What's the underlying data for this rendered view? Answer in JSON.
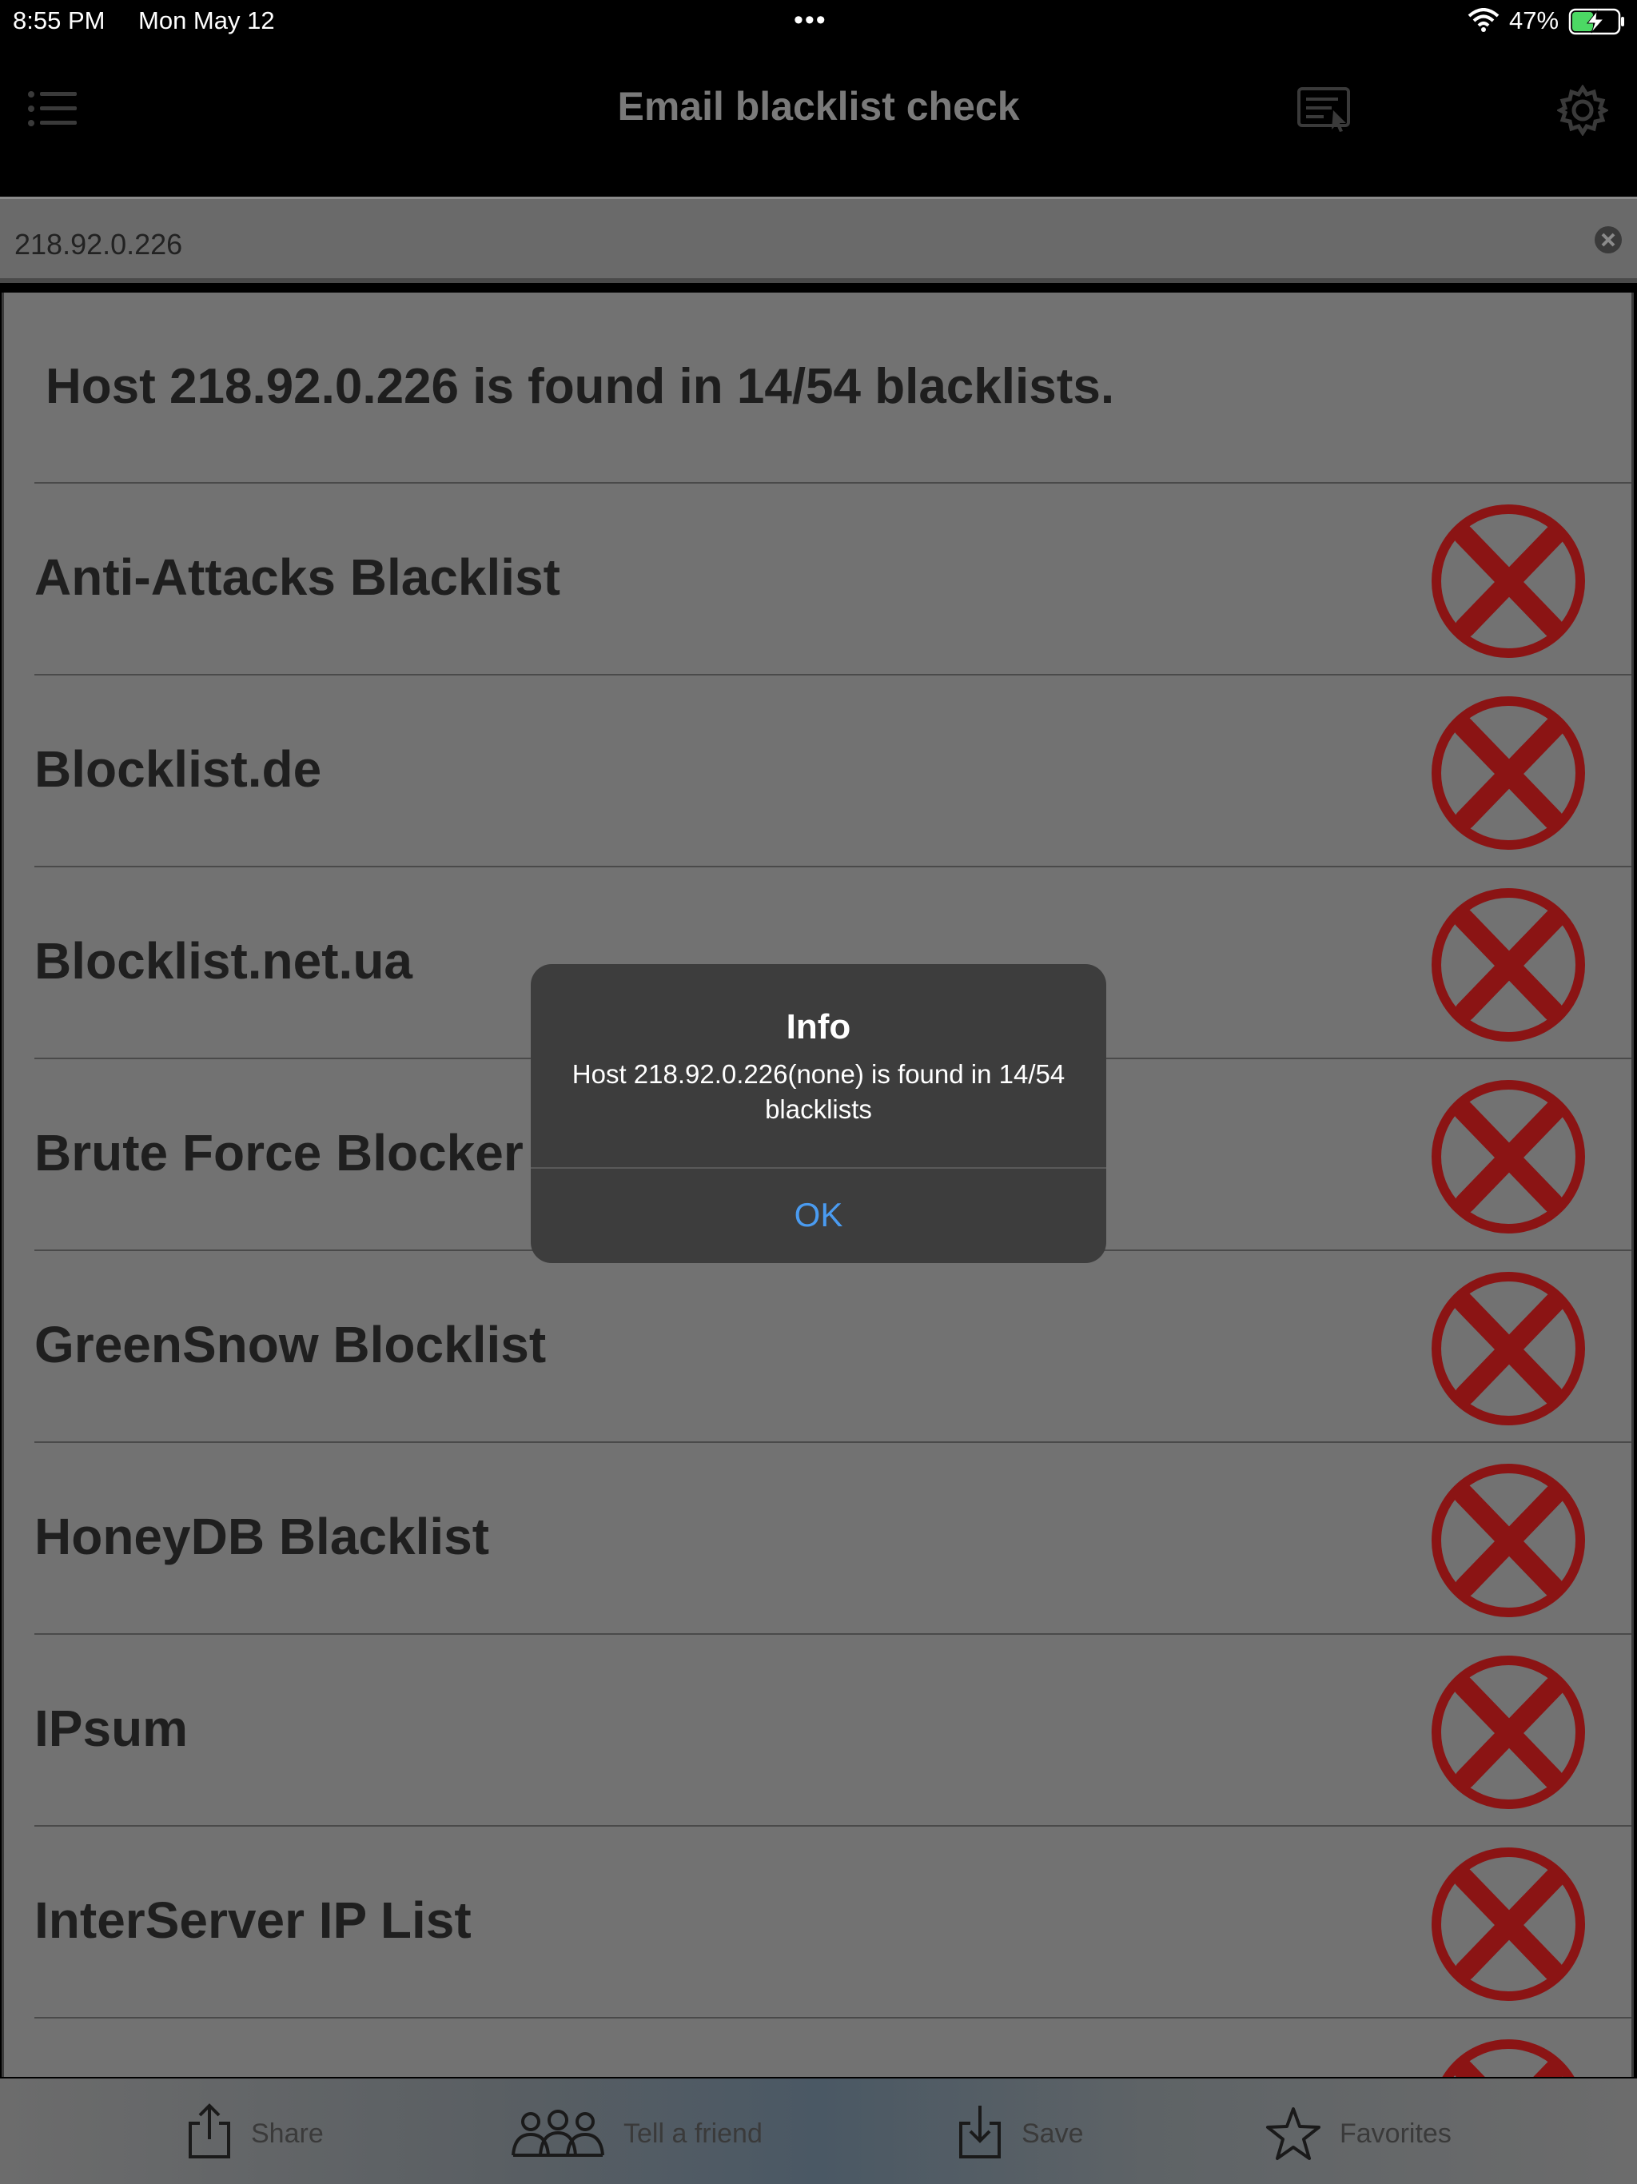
{
  "status_bar": {
    "time": "8:55 PM",
    "date": "Mon May 12",
    "battery_percent": "47%",
    "battery_level": 0.47
  },
  "nav": {
    "title": "Email blacklist check",
    "menu_icon": "list-icon",
    "report_icon": "report-icon",
    "settings_icon": "gear-icon"
  },
  "search": {
    "value": "218.92.0.226",
    "clear_icon": "clear-icon"
  },
  "summary": "Host 218.92.0.226 is found in 14/54 blacklists.",
  "blacklists": [
    {
      "name": "Anti-Attacks Blacklist",
      "status": "listed"
    },
    {
      "name": "Blocklist.de",
      "status": "listed"
    },
    {
      "name": "Blocklist.net.ua",
      "status": "listed"
    },
    {
      "name": "Brute Force Blocker",
      "status": "listed"
    },
    {
      "name": "GreenSnow Blocklist",
      "status": "listed"
    },
    {
      "name": "HoneyDB Blacklist",
      "status": "listed"
    },
    {
      "name": "IPsum",
      "status": "listed"
    },
    {
      "name": "InterServer IP List",
      "status": "listed"
    }
  ],
  "bottom_bar": {
    "share": "Share",
    "tell_a_friend": "Tell a friend",
    "save": "Save",
    "favorites": "Favorites"
  },
  "alert": {
    "title": "Info",
    "message": "Host 218.92.0.226(none) is found in 14/54 blacklists",
    "ok": "OK"
  },
  "colors": {
    "listed_red": "#8b1414",
    "alert_button_blue": "#4a9bf0"
  }
}
